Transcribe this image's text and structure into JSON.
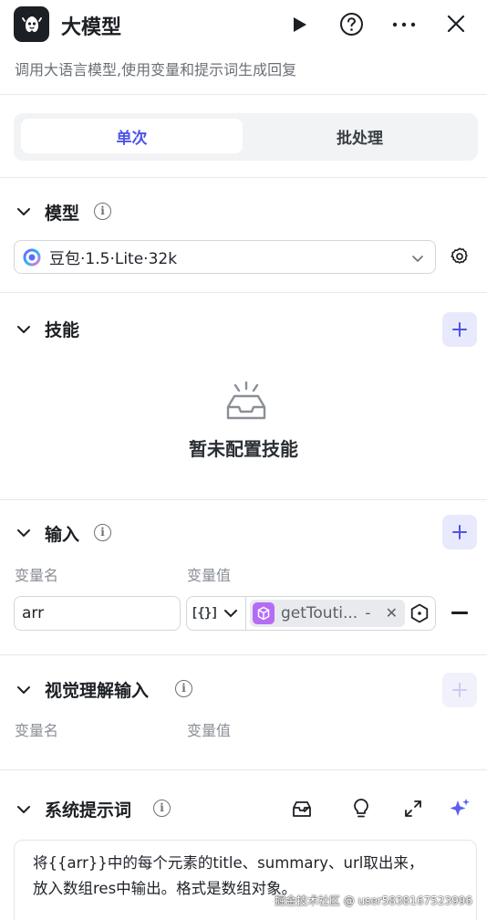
{
  "header": {
    "title": "大模型",
    "description": "调用大语言模型,使用变量和提示词生成回复"
  },
  "tabs": [
    {
      "label": "单次",
      "active": true
    },
    {
      "label": "批处理",
      "active": false
    }
  ],
  "model_section": {
    "title": "模型",
    "selected_model": "豆包·1.5·Lite·32k"
  },
  "skills_section": {
    "title": "技能",
    "empty_text": "暂未配置技能"
  },
  "input_section": {
    "title": "输入",
    "col_name": "变量名",
    "col_value": "变量值",
    "rows": [
      {
        "name": "arr",
        "type_icon": "[{}]",
        "value_tag": "getTouti...",
        "value_suffix": "-"
      }
    ]
  },
  "visual_section": {
    "title": "视觉理解输入",
    "col_name": "变量名",
    "col_value": "变量值"
  },
  "system_prompt_section": {
    "title": "系统提示词",
    "text_line1": "将{{arr}}中的每个元素的title、summary、url取出来，",
    "text_line2": "放入数组res中输出。格式是数组对象。"
  },
  "watermark": "掘金技术社区 @ user5838167523996",
  "colors": {
    "accent": "#4d53e8",
    "divider": "#e6e8eb",
    "tag_purple": "#b46cf5"
  }
}
